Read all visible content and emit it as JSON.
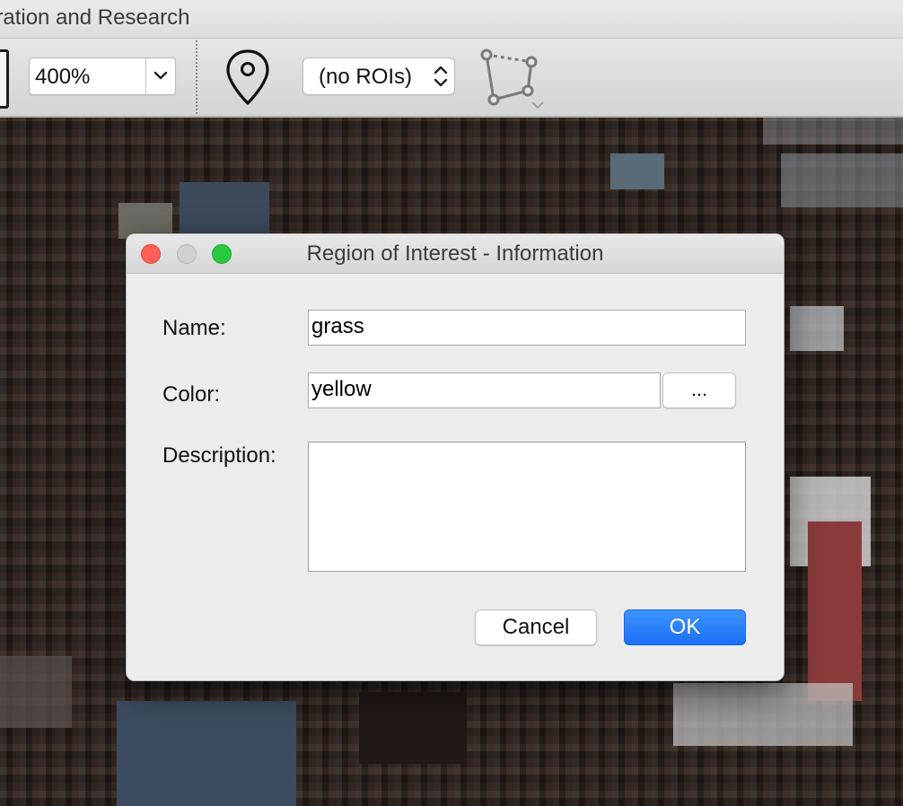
{
  "window": {
    "title": "oration and Research"
  },
  "toolbar": {
    "zoom": {
      "value": "400%",
      "dropdown_icon": "chevron-down-icon"
    },
    "marker_icon": "map-pin-icon",
    "roi_select": {
      "value": "(no ROIs)",
      "arrows_icon": "up-down-chevron-icon"
    },
    "polygon_tool_icon": "polygon-roi-icon"
  },
  "dialog": {
    "title": "Region of Interest - Information",
    "name": {
      "label": "Name:",
      "value": "grass"
    },
    "color": {
      "label": "Color:",
      "value": "yellow",
      "picker_label": "..."
    },
    "description": {
      "label": "Description:",
      "value": ""
    },
    "buttons": {
      "cancel": "Cancel",
      "ok": "OK"
    }
  },
  "colors": {
    "close": "#fe5f57",
    "minimize": "#d0d0d0",
    "zoom": "#2ac840",
    "accent": "#1b6ff5"
  }
}
